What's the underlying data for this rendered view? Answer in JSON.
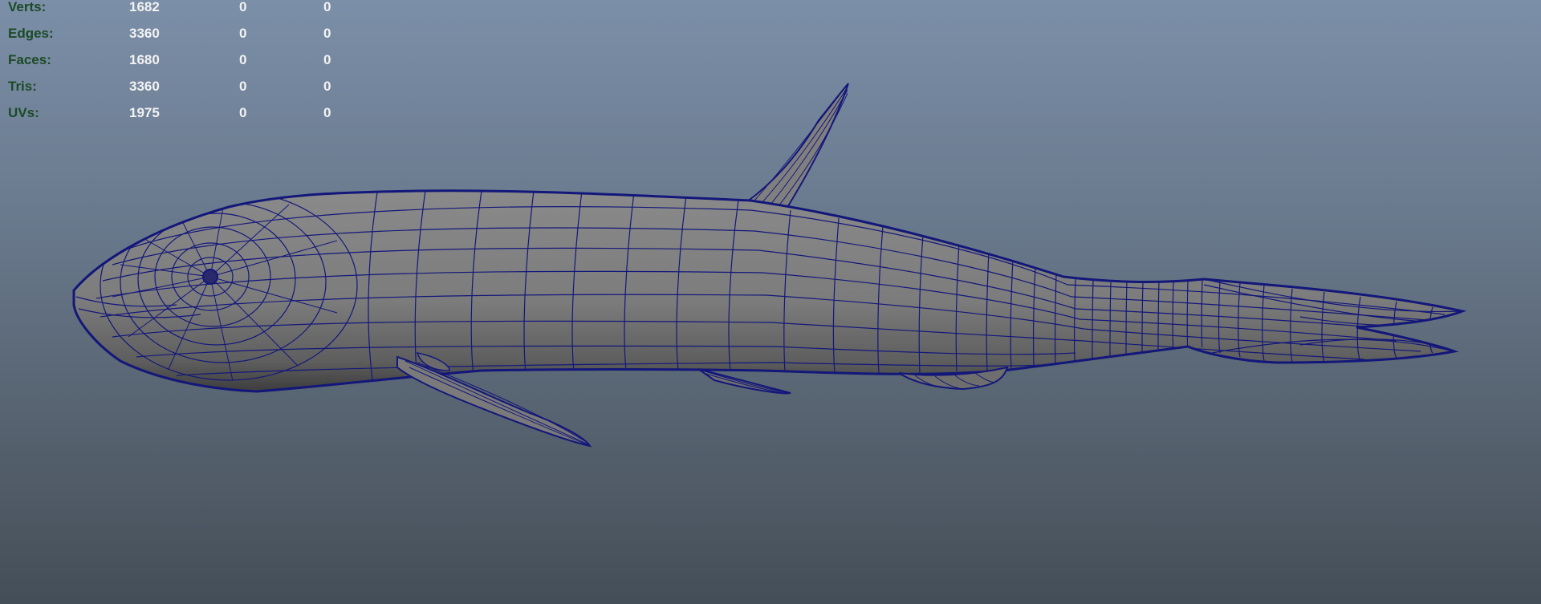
{
  "hud": {
    "rows": [
      {
        "label": "Verts:",
        "values": [
          "1682",
          "0",
          "0"
        ]
      },
      {
        "label": "Edges:",
        "values": [
          "3360",
          "0",
          "0"
        ]
      },
      {
        "label": "Faces:",
        "values": [
          "1680",
          "0",
          "0"
        ]
      },
      {
        "label": "Tris:",
        "values": [
          "3360",
          "0",
          "0"
        ]
      },
      {
        "label": "UVs:",
        "values": [
          "1975",
          "0",
          "0"
        ]
      }
    ]
  },
  "colors": {
    "background_top": "#7b8fa8",
    "background_bottom": "#444e58",
    "hud_label": "#1c4a26",
    "hud_value": "#f2f2f2",
    "mesh_fill": "#7e7e7e",
    "wireframe": "#13177a"
  }
}
